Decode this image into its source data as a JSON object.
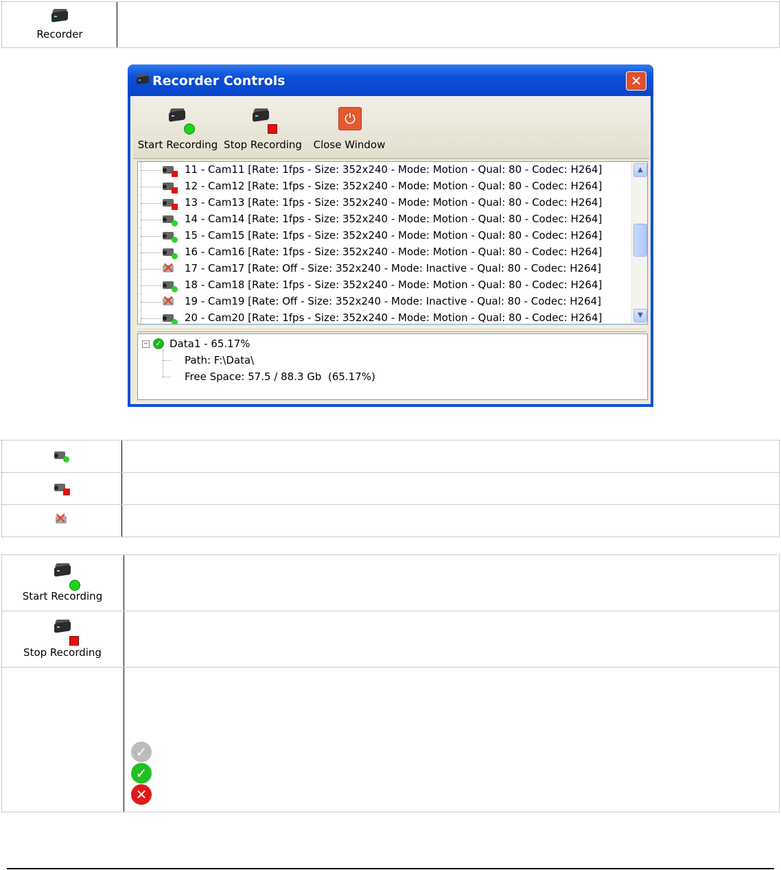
{
  "header": {
    "recorder_label": "Recorder"
  },
  "window": {
    "title": "Recorder Controls",
    "close_glyph": "✕",
    "toolbar": {
      "start_label": "Start Recording",
      "stop_label": "Stop Recording",
      "close_label": "Close Window"
    },
    "cameras": [
      {
        "text": "11 - Cam11 [Rate: 1fps - Size: 352x240 - Mode: Motion - Qual: 80 - Codec: H264]",
        "status": "stopped"
      },
      {
        "text": "12 - Cam12 [Rate: 1fps - Size: 352x240 - Mode: Motion - Qual: 80 - Codec: H264]",
        "status": "stopped"
      },
      {
        "text": "13 - Cam13 [Rate: 1fps - Size: 352x240 - Mode: Motion - Qual: 80 - Codec: H264]",
        "status": "stopped"
      },
      {
        "text": "14 - Cam14 [Rate: 1fps - Size: 352x240 - Mode: Motion - Qual: 80 - Codec: H264]",
        "status": "recording"
      },
      {
        "text": "15 - Cam15 [Rate: 1fps - Size: 352x240 - Mode: Motion - Qual: 80 - Codec: H264]",
        "status": "recording"
      },
      {
        "text": "16 - Cam16 [Rate: 1fps - Size: 352x240 - Mode: Motion - Qual: 80 - Codec: H264]",
        "status": "recording"
      },
      {
        "text": "17 - Cam17 [Rate: Off - Size: 352x240 - Mode: Inactive - Qual: 80 - Codec: H264]",
        "status": "inactive"
      },
      {
        "text": "18 - Cam18 [Rate: 1fps - Size: 352x240 - Mode: Motion - Qual: 80 - Codec: H264]",
        "status": "recording"
      },
      {
        "text": "19 - Cam19 [Rate: Off - Size: 352x240 - Mode: Inactive - Qual: 80 - Codec: H264]",
        "status": "inactive"
      },
      {
        "text": "20 - Cam20 [Rate: 1fps - Size: 352x240 - Mode: Motion - Qual: 80 - Codec: H264]",
        "status": "recording"
      }
    ],
    "data_tree": {
      "root": "Data1 - 65.17%",
      "path": "Path: F:\\Data\\",
      "free_space": "Free Space: 57.5 / 88.3 Gb  (65.17%)"
    }
  },
  "legend_table": {
    "start_label": "Start Recording",
    "stop_label": "Stop Recording"
  }
}
